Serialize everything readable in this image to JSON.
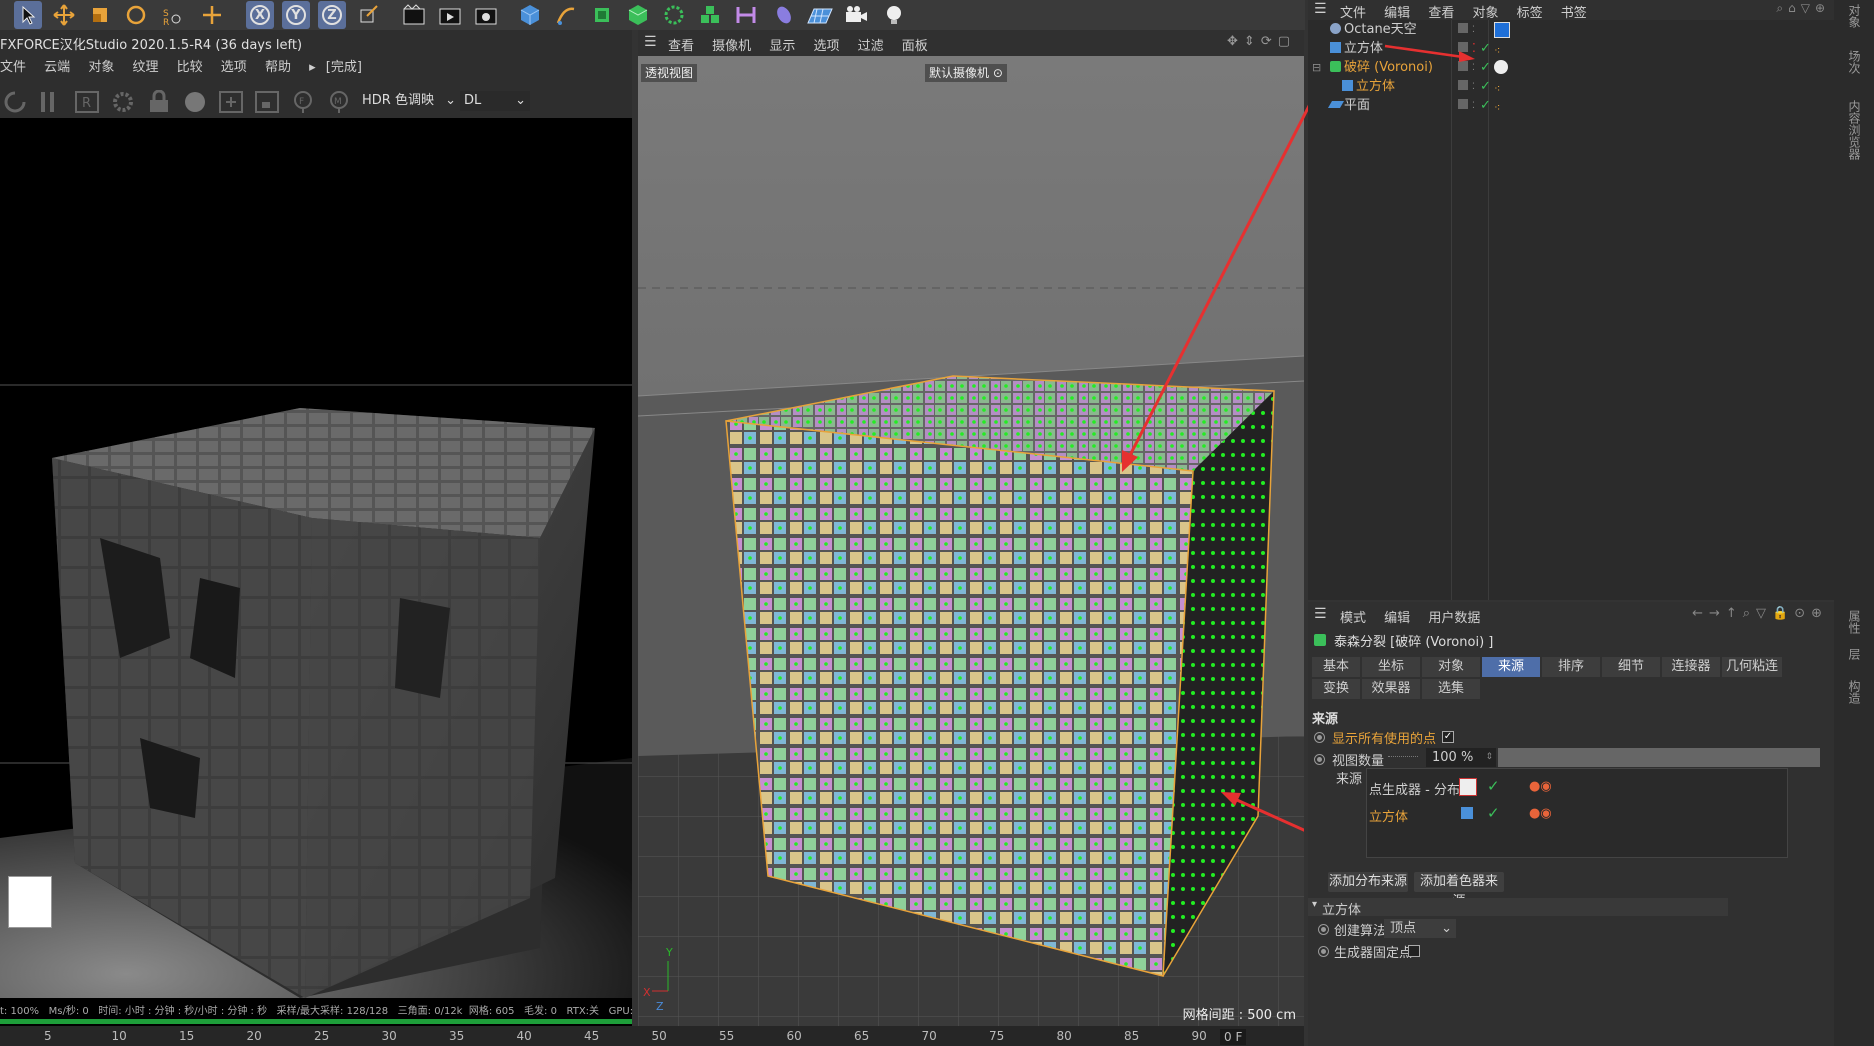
{
  "app": {
    "title": "FXFORCE汉化Studio 2020.1.5-R4 (36 days left)"
  },
  "render_view": {
    "menu": [
      "文件",
      "云端",
      "对象",
      "纹理",
      "比较",
      "选项",
      "帮助"
    ],
    "status_label": "[完成]",
    "hdr_dropdown": "HDR 色调映",
    "kernel_dropdown": "DL",
    "status_bar": {
      "zoom": "t: 100%",
      "ms": "Ms/秒: 0",
      "time": "时间: 小时 : 分钟 : 秒/小时 : 分钟 : 秒",
      "samples": "采样/最大采样: 128/128",
      "triangles": "三角面: 0/12k",
      "mesh": "网格: 605",
      "hair": "毛发: 0",
      "rtx": "RTX:关",
      "gpu": "GPU:"
    }
  },
  "viewport": {
    "menu": [
      "查看",
      "摄像机",
      "显示",
      "选项",
      "过滤",
      "面板"
    ],
    "view_name": "透视视图",
    "camera_label": "默认摄像机",
    "grid_spacing": "网格间距 : 500 cm"
  },
  "timeline": {
    "ticks": [
      "5",
      "10",
      "15",
      "20",
      "25",
      "30",
      "35",
      "40",
      "45",
      "50",
      "55",
      "60",
      "65",
      "70",
      "75",
      "80",
      "85",
      "90"
    ],
    "frame": "0 F"
  },
  "object_manager": {
    "menu": [
      "文件",
      "编辑",
      "查看",
      "对象",
      "标签",
      "书签"
    ],
    "objects": [
      {
        "name": "Octane天空",
        "indent": 0,
        "highlight": false
      },
      {
        "name": "立方体",
        "indent": 0,
        "highlight": false
      },
      {
        "name": "破碎 (Voronoi)",
        "indent": 0,
        "highlight": true
      },
      {
        "name": "立方体",
        "indent": 1,
        "highlight": true
      },
      {
        "name": "平面",
        "indent": 0,
        "highlight": false
      }
    ]
  },
  "attribute_manager": {
    "menu": [
      "模式",
      "编辑",
      "用户数据"
    ],
    "object_title": "泰森分裂 [破碎 (Voronoi) ]",
    "tabs_row1": [
      "基本",
      "坐标",
      "对象",
      "来源",
      "排序",
      "细节",
      "连接器",
      "几何粘连"
    ],
    "tabs_row2": [
      "变换",
      "效果器",
      "选集"
    ],
    "active_tab": "来源",
    "section_title": "来源",
    "show_all_points_label": "显示所有使用的点",
    "viewport_amount_label": "视图数量",
    "viewport_amount_value": "100 %",
    "sources_label": "来源",
    "sources": [
      {
        "name": "点生成器 - 分布",
        "highlight": false
      },
      {
        "name": "立方体",
        "highlight": true
      }
    ],
    "add_distribution_button": "添加分布来源",
    "add_shader_button": "添加着色器来源",
    "subsection_title": "立方体",
    "creation_method_label": "创建算法",
    "creation_method_value": "顶点",
    "generator_fixed_label": "生成器固定点"
  },
  "right_sidebar": {
    "labels_top": [
      "对象",
      "场次",
      "内容浏览器"
    ],
    "labels_bottom": [
      "属性",
      "层",
      "构造"
    ]
  },
  "colors": {
    "accent_blue": "#4e6ea9",
    "highlight_orange": "#e8a33a",
    "annotation_red": "#e63030",
    "point_green": "#22ee22"
  }
}
